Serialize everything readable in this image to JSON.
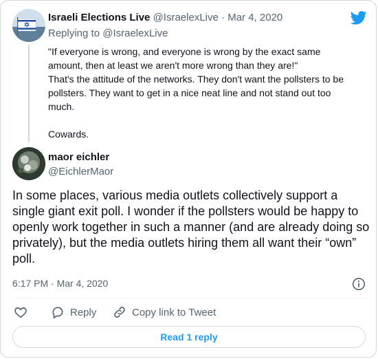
{
  "parent_tweet": {
    "display_name": "Israeli Elections Live",
    "handle": "@IsraelexLive",
    "separator": "·",
    "date": "Mar 4, 2020",
    "replying_label": "Replying to",
    "replying_handle": "@IsraelexLive",
    "lines": [
      "\"If everyone is wrong, and everyone is wrong by the exact same",
      "amount, then at least we aren't more wrong than they are!\"",
      "That's the attitude of the networks. They don't want the pollsters to be",
      "pollsters. They want to get in a nice neat line and not stand out too",
      "much.",
      "Cowards."
    ]
  },
  "main_tweet": {
    "display_name": "maor eichler",
    "handle": "@EichlerMaor",
    "text": "In some places, various media outlets collectively support a single giant exit poll. I wonder if the pollsters would be happy to openly work together in such a manner (and are already doing so privately), but the media outlets hiring them all want their “own” poll.",
    "timestamp": "6:17 PM · Mar 4, 2020"
  },
  "actions": {
    "reply_label": "Reply",
    "copy_label": "Copy link to Tweet",
    "read_replies_label": "Read 1 reply"
  },
  "icons": {
    "bird": "twitter-bird-icon",
    "info": "info-icon",
    "like": "heart-icon",
    "reply": "speech-bubble-icon",
    "copy": "link-icon"
  },
  "colors": {
    "brand": "#1d9bf0",
    "text": "#0f1419",
    "secondary": "#536471",
    "border": "#cfd9de"
  }
}
